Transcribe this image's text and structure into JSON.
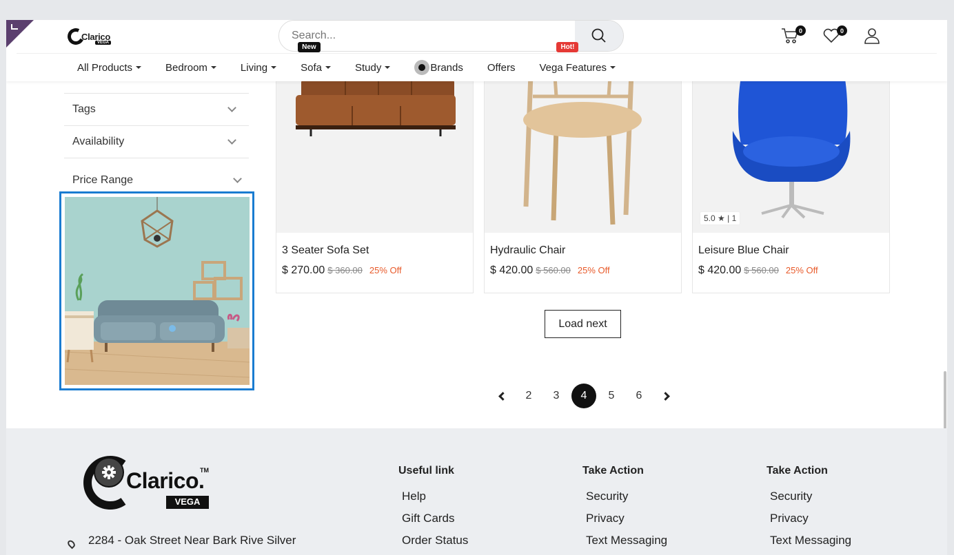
{
  "header": {
    "logo": "Clarico",
    "logo_badge": "VEGA",
    "search_placeholder": "Search...",
    "cart_count": "0",
    "wishlist_count": "0"
  },
  "nav": {
    "items": [
      {
        "label": "All Products"
      },
      {
        "label": "Bedroom"
      },
      {
        "label": "Living"
      },
      {
        "label": "Sofa",
        "tag": "New"
      },
      {
        "label": "Study"
      },
      {
        "label": "Brands"
      },
      {
        "label": "Offers"
      },
      {
        "label": "Vega Features",
        "tag": "Hot!"
      }
    ]
  },
  "filters": {
    "tags": "Tags",
    "availability": "Availability",
    "price_range": "Price Range"
  },
  "products": [
    {
      "title": "3 Seater Sofa Set",
      "price": "$ 270.00",
      "old_price": "$ 360.00",
      "discount": "25% Off"
    },
    {
      "title": "Hydraulic Chair",
      "price": "$ 420.00",
      "old_price": "$ 560.00",
      "discount": "25% Off"
    },
    {
      "title": "Leisure Blue Chair",
      "price": "$ 420.00",
      "old_price": "$ 560.00",
      "discount": "25% Off",
      "rating": "5.0",
      "reviews": "| 1"
    }
  ],
  "load_next": "Load next",
  "pagination": {
    "pages": [
      "2",
      "3",
      "4",
      "5",
      "6"
    ],
    "active": "4"
  },
  "footer": {
    "logo": "Clarico.",
    "logo_tm": "TM",
    "logo_badge": "VEGA",
    "address": "2284 - Oak Street Near Bark Rive Silver",
    "useful_link": {
      "heading": "Useful link",
      "links": [
        "Help",
        "Gift Cards",
        "Order Status"
      ]
    },
    "take_action_1": {
      "heading": "Take Action",
      "links": [
        "Security",
        "Privacy",
        "Text Messaging"
      ]
    },
    "take_action_2": {
      "heading": "Take Action",
      "links": [
        "Security",
        "Privacy",
        "Text Messaging"
      ]
    }
  },
  "colors": {
    "accent": "#111111",
    "hot": "#e53935",
    "discount": "#e85a2a",
    "selection": "#1a7cd1",
    "editor_badge": "#5b3f6e"
  }
}
